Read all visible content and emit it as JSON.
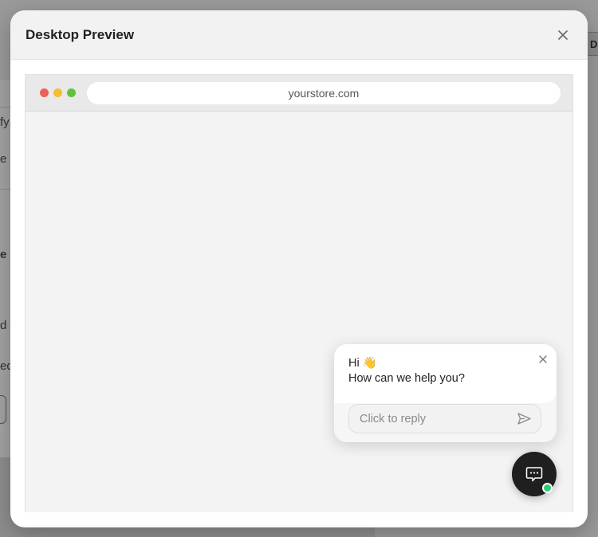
{
  "modal": {
    "title": "Desktop Preview"
  },
  "browser": {
    "url": "yourstore.com"
  },
  "chat": {
    "greeting": "Hi 👋",
    "question": "How can we help you?",
    "reply_placeholder": "Click to reply"
  },
  "background": {
    "fragments": [
      "fy",
      "e c",
      "e h",
      "d t",
      "ed"
    ],
    "right_button": "D"
  },
  "icons": {
    "modal_close": "close-icon",
    "chat_close": "close-icon",
    "send": "send-icon",
    "launcher": "chat-bubble-icon"
  },
  "colors": {
    "launcher": "#1f1f1f",
    "online": "#2ecc71",
    "traffic_red": "#ed5f58",
    "traffic_yellow": "#f5be34",
    "traffic_green": "#5ec43f"
  }
}
